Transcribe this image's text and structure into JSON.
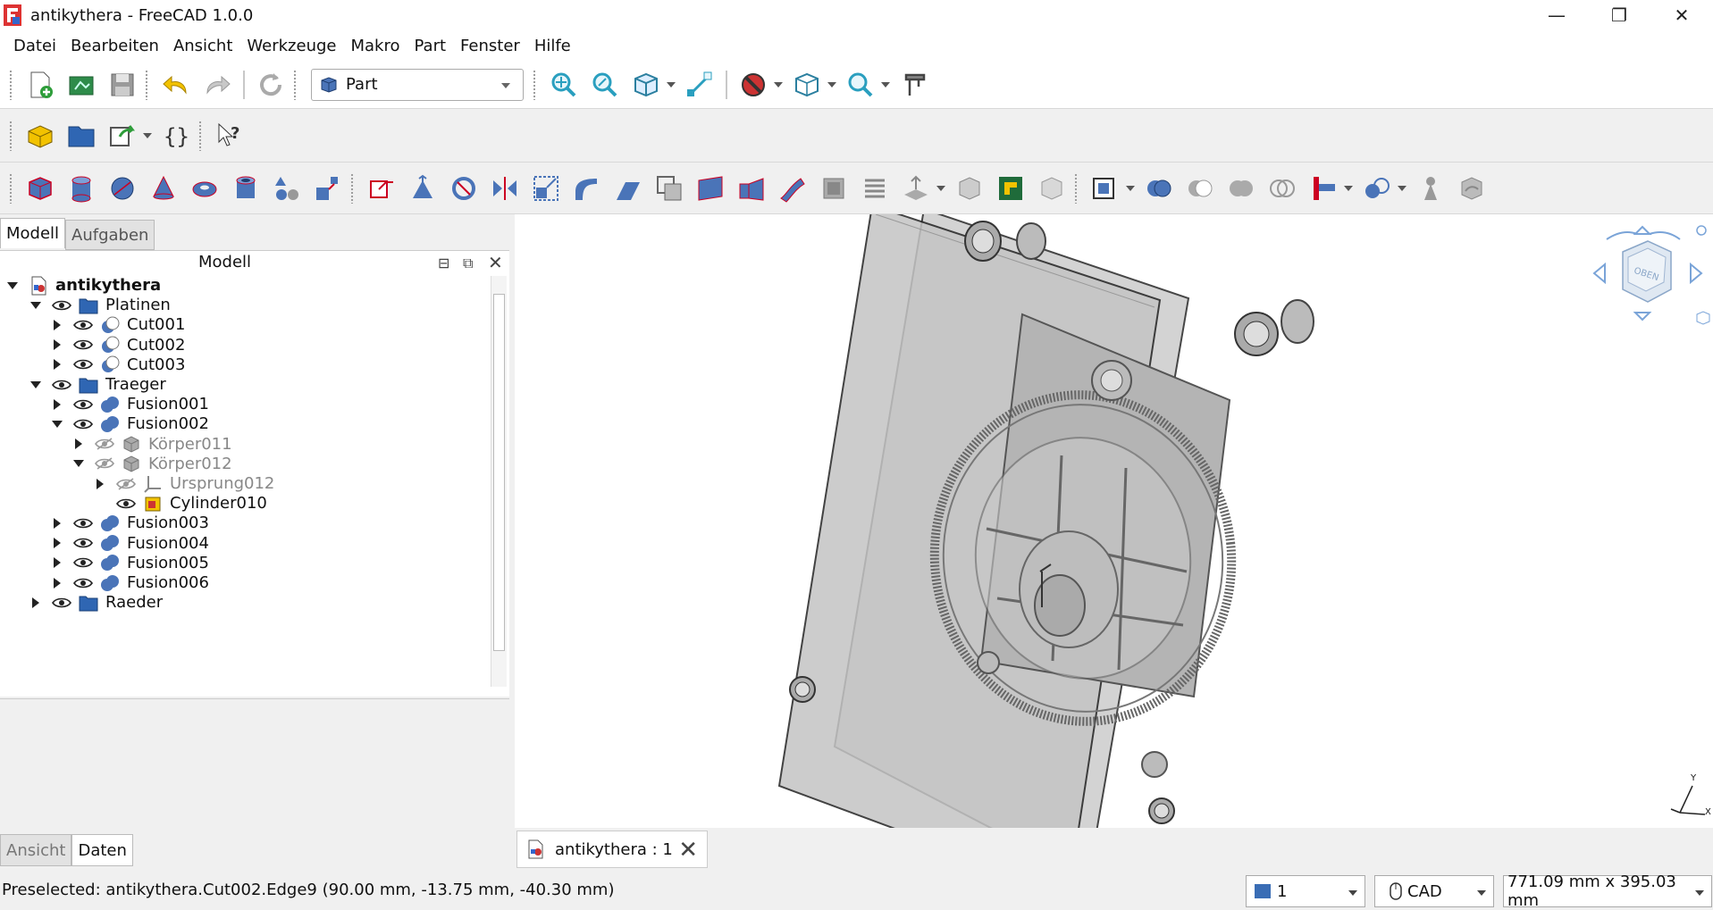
{
  "window": {
    "title": "antikythera - FreeCAD 1.0.0"
  },
  "menu": [
    {
      "label": "Datei"
    },
    {
      "label": "Bearbeiten"
    },
    {
      "label": "Ansicht"
    },
    {
      "label": "Werkzeuge"
    },
    {
      "label": "Makro"
    },
    {
      "label": "Part"
    },
    {
      "label": "Fenster"
    },
    {
      "label": "Hilfe"
    }
  ],
  "toolbar": {
    "workbench": "Part"
  },
  "panel": {
    "tabs": [
      "Modell",
      "Aufgaben"
    ],
    "title": "Modell",
    "bottom_tabs": [
      "Ansicht",
      "Daten"
    ]
  },
  "tree": [
    {
      "label": "antikythera",
      "level": 0,
      "expand": "open",
      "icon": "document-icon",
      "eye": "none",
      "bold": true
    },
    {
      "label": "Platinen",
      "level": 1,
      "expand": "open",
      "icon": "folder-icon",
      "eye": "visible"
    },
    {
      "label": "Cut001",
      "level": 2,
      "expand": "closed",
      "icon": "cut-icon",
      "eye": "visible"
    },
    {
      "label": "Cut002",
      "level": 2,
      "expand": "closed",
      "icon": "cut-icon",
      "eye": "visible"
    },
    {
      "label": "Cut003",
      "level": 2,
      "expand": "closed",
      "icon": "cut-icon",
      "eye": "visible"
    },
    {
      "label": "Traeger",
      "level": 1,
      "expand": "open",
      "icon": "folder-icon",
      "eye": "visible"
    },
    {
      "label": "Fusion001",
      "level": 2,
      "expand": "closed",
      "icon": "fusion-icon",
      "eye": "visible"
    },
    {
      "label": "Fusion002",
      "level": 2,
      "expand": "open",
      "icon": "fusion-icon",
      "eye": "visible"
    },
    {
      "label": "Körper011",
      "level": 3,
      "expand": "closed",
      "icon": "body-icon",
      "eye": "hidden",
      "dim": true
    },
    {
      "label": "Körper012",
      "level": 3,
      "expand": "open",
      "icon": "body-icon",
      "eye": "hidden",
      "dim": true
    },
    {
      "label": "Ursprung012",
      "level": 4,
      "expand": "closed",
      "icon": "origin-icon",
      "eye": "hidden",
      "dim": true
    },
    {
      "label": "Cylinder010",
      "level": 4,
      "expand": "none",
      "icon": "cylinder-feature-icon",
      "eye": "visible"
    },
    {
      "label": "Fusion003",
      "level": 2,
      "expand": "closed",
      "icon": "fusion-icon",
      "eye": "visible"
    },
    {
      "label": "Fusion004",
      "level": 2,
      "expand": "closed",
      "icon": "fusion-icon",
      "eye": "visible"
    },
    {
      "label": "Fusion005",
      "level": 2,
      "expand": "closed",
      "icon": "fusion-icon",
      "eye": "visible"
    },
    {
      "label": "Fusion006",
      "level": 2,
      "expand": "closed",
      "icon": "fusion-icon",
      "eye": "visible"
    },
    {
      "label": "Raeder",
      "level": 1,
      "expand": "closed",
      "icon": "folder-icon",
      "eye": "visible"
    }
  ],
  "document_tab": {
    "label": "antikythera : 1"
  },
  "navcube": {
    "face_label": "OBEN"
  },
  "axes": {
    "x": "X",
    "y": "Y"
  },
  "status": {
    "message": "Preselected: antikythera.Cut002.Edge9 (90.00 mm, -13.75 mm, -40.30 mm)",
    "view_index": "1",
    "nav_style": "CAD",
    "dimensions": "771.09 mm x 395.03 mm"
  },
  "colors": {
    "accent_blue": "#3a6db5",
    "part_blue": "#4a74b8",
    "tool_teal": "#2a9fbf"
  }
}
